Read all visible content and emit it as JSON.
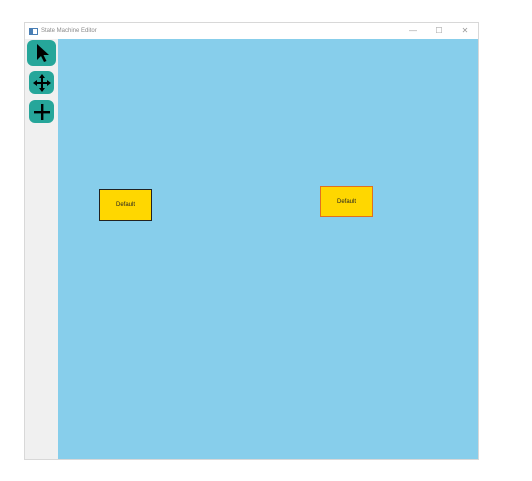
{
  "window": {
    "title": "State Machine Editor",
    "controls": {
      "minimize": "—",
      "maximize": "☐",
      "close": "✕"
    }
  },
  "toolbar": {
    "tools": [
      {
        "name": "select",
        "icon": "cursor-arrow-icon",
        "active": true
      },
      {
        "name": "move",
        "icon": "move-arrows-icon"
      },
      {
        "name": "add",
        "icon": "plus-icon"
      }
    ]
  },
  "canvas": {
    "background": "#87ceeb",
    "states": [
      {
        "label": "Default",
        "fill": "#ffd700",
        "border": "#222222"
      },
      {
        "label": "Default",
        "fill": "#ffd700",
        "border": "#e07020"
      }
    ]
  },
  "colors": {
    "tool_accent": "#26a69a"
  }
}
